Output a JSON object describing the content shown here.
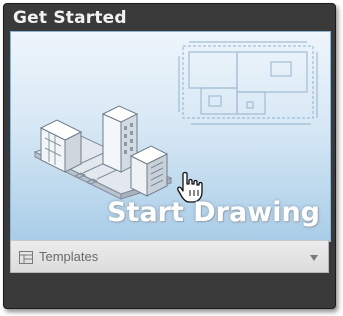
{
  "panel": {
    "title": "Get Started"
  },
  "tile": {
    "label": "Start Drawing",
    "illustration": "city-buildings-and-floor-plan"
  },
  "footer": {
    "templates_label": "Templates",
    "templates_icon": "template-icon",
    "dropdown_icon": "chevron-down-icon"
  }
}
